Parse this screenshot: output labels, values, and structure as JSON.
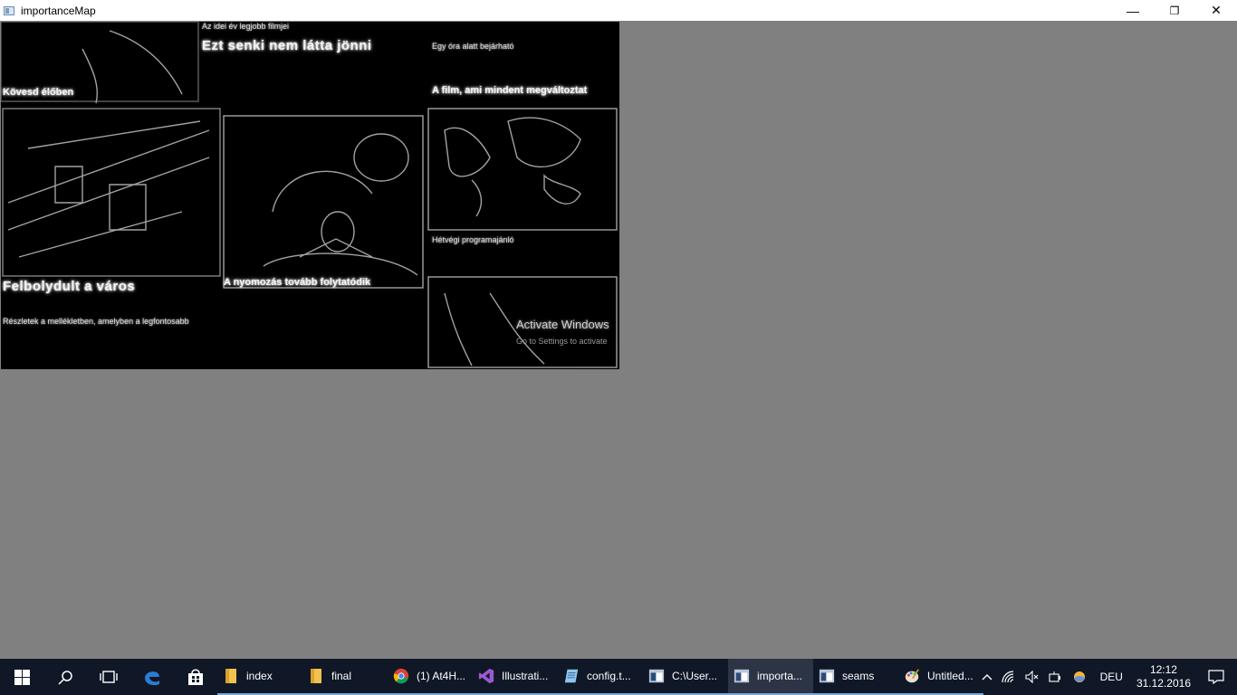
{
  "window": {
    "title": "importanceMap",
    "minimize": "—",
    "restore": "❐",
    "close": "✕"
  },
  "canvas": {
    "texts": [
      {
        "text": "Az idei év legjobb filmjei",
        "cls": "small"
      },
      {
        "text": "Ezt senki nem látta jönni",
        "cls": "big"
      },
      {
        "text": "Kövesd élőben",
        "cls": "med"
      },
      {
        "text": "Egy óra alatt bejárható",
        "cls": "small"
      },
      {
        "text": "A film, ami mindent megváltoztat",
        "cls": "med"
      },
      {
        "text": "Felbolydult a város",
        "cls": "big"
      },
      {
        "text": "Részletek a mellékletben, amelyben a legfontosabb",
        "cls": "small"
      },
      {
        "text": "A nyomozás tovább folytatódik",
        "cls": "med"
      },
      {
        "text": "Hétvégi programajánló",
        "cls": "small"
      }
    ],
    "watermark_title": "Activate Windows",
    "watermark_sub": "Go to Settings to activate"
  },
  "taskbar": {
    "start_icon": "windows-logo-icon",
    "search_icon": "search-icon",
    "taskview_icon": "task-view-icon",
    "apps": [
      {
        "label": "",
        "icon": "edge-icon",
        "color": "#2b7cd3"
      },
      {
        "label": "",
        "icon": "store-icon",
        "color": "#ffffff"
      },
      {
        "label": "index",
        "icon": "folder-icon",
        "color": "#f2c14e"
      },
      {
        "label": "final",
        "icon": "folder-icon",
        "color": "#f2c14e"
      },
      {
        "label": "(1) At4H...",
        "icon": "chrome-icon",
        "color": "#4caf50"
      },
      {
        "label": "Illustrati...",
        "icon": "visual-studio-icon",
        "color": "#9b59d0"
      },
      {
        "label": "config.t...",
        "icon": "notepad-icon",
        "color": "#8ec5f0"
      },
      {
        "label": "C:\\User...",
        "icon": "console-window-icon",
        "color": "#b8c7d9"
      },
      {
        "label": "importa...",
        "icon": "app-window-icon",
        "color": "#b8c7d9"
      },
      {
        "label": "seams",
        "icon": "app-window-icon",
        "color": "#b8c7d9"
      },
      {
        "label": "Untitled...",
        "icon": "paint-icon",
        "color": "#f0c040"
      }
    ],
    "language": "DEU",
    "time": "12:12",
    "date": "31.12.2016"
  }
}
